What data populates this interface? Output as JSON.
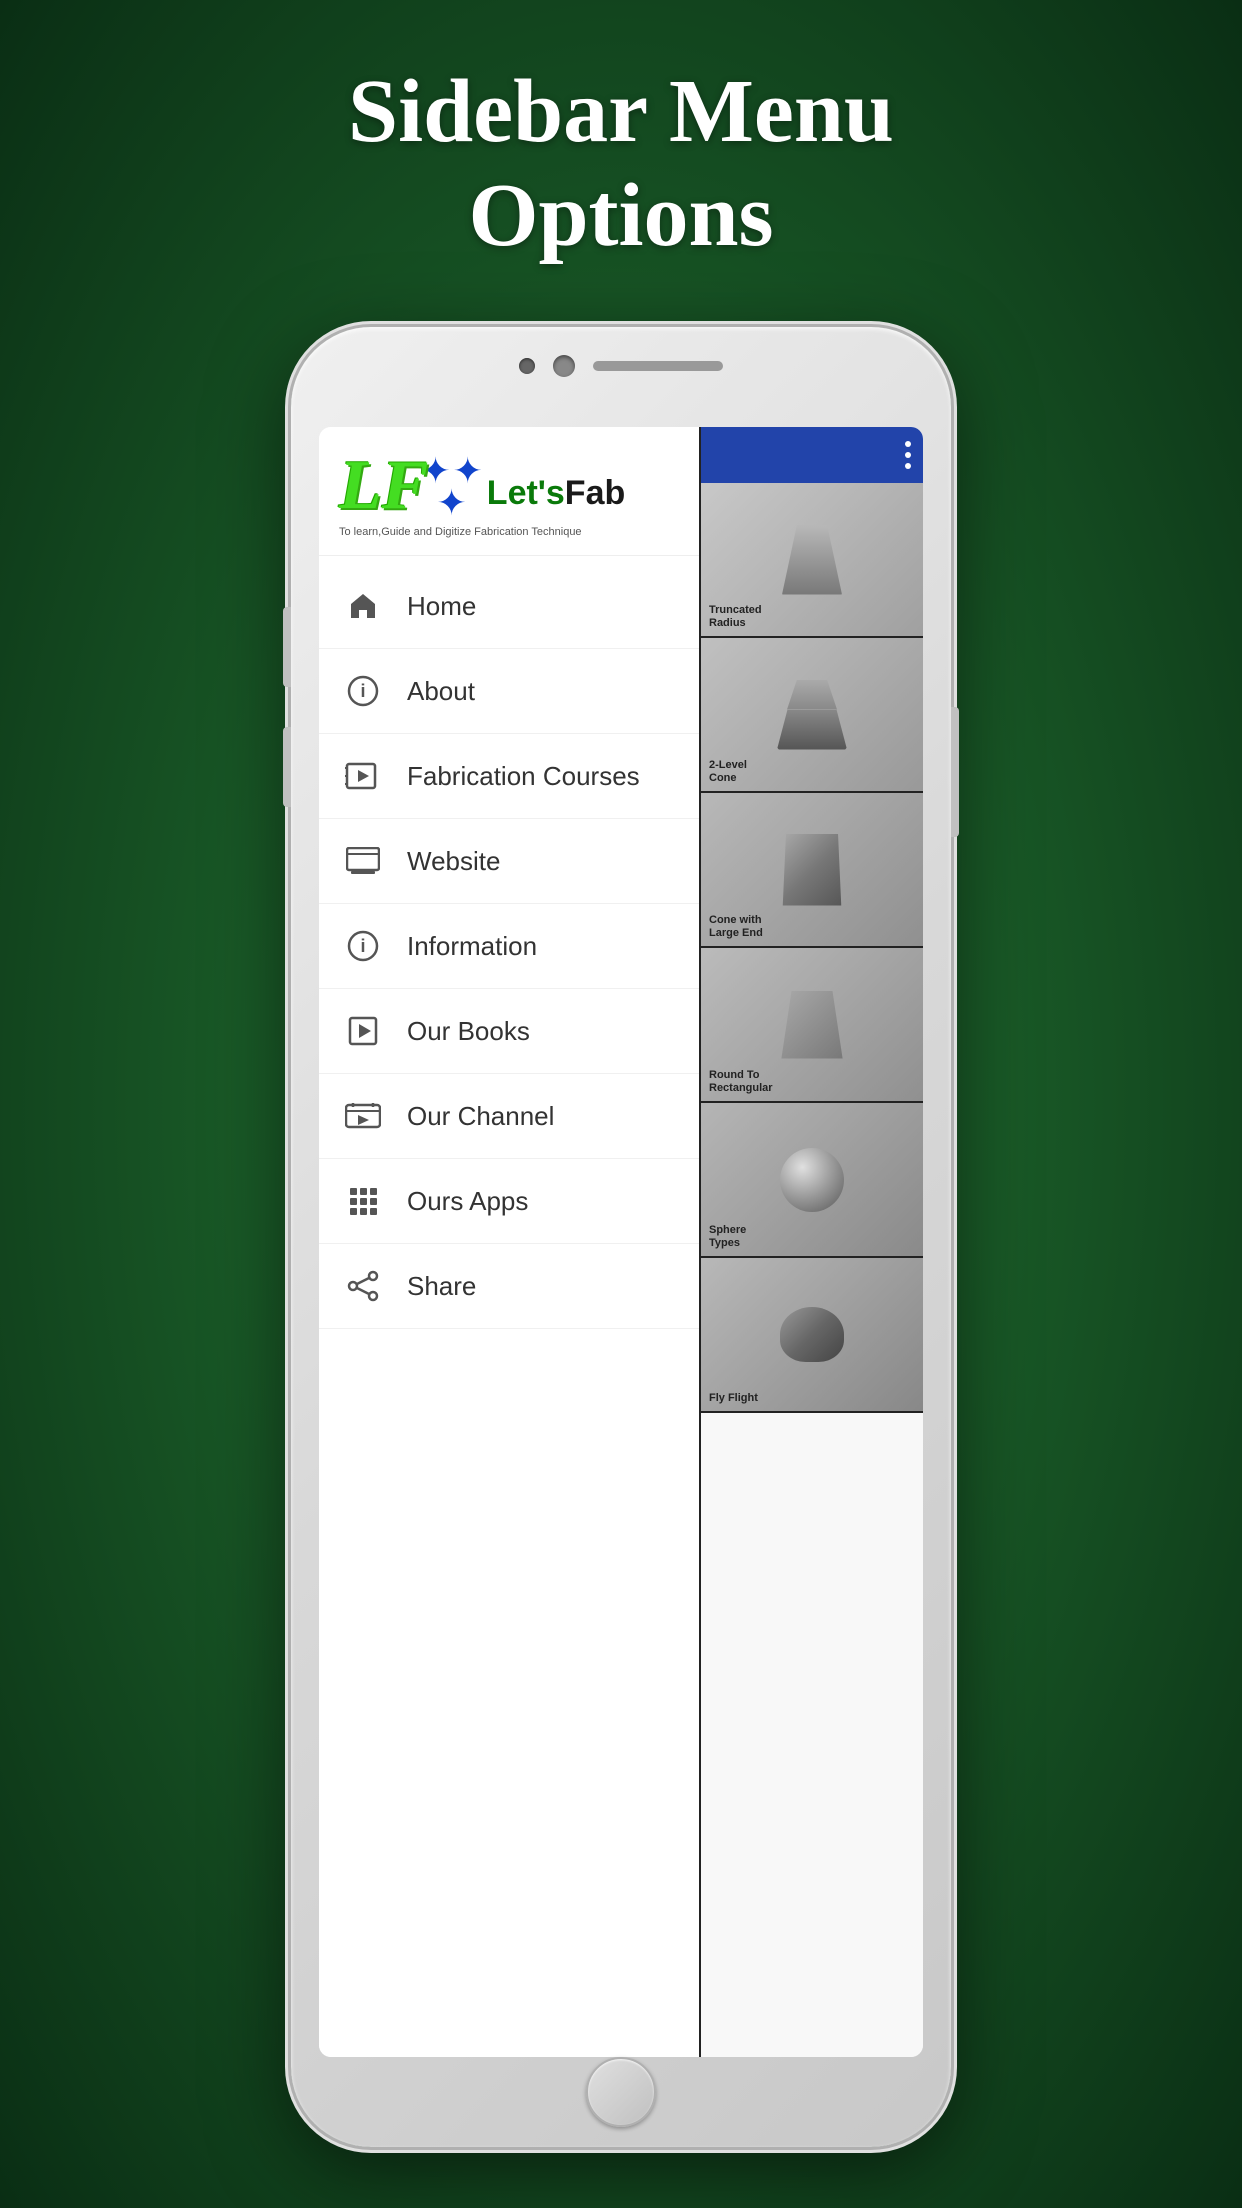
{
  "page": {
    "title_line1": "Sidebar Menu",
    "title_line2": "Options"
  },
  "brand": {
    "letters": "LF",
    "name_colored": "Let's",
    "name_dark": "Fab",
    "tagline": "To learn,Guide and Digitize Fabrication Technique"
  },
  "menu": {
    "items": [
      {
        "id": "home",
        "label": "Home",
        "icon": "home-icon"
      },
      {
        "id": "about",
        "label": "About",
        "icon": "info-icon"
      },
      {
        "id": "fabrication-courses",
        "label": "Fabrication Courses",
        "icon": "courses-icon"
      },
      {
        "id": "website",
        "label": "Website",
        "icon": "website-icon"
      },
      {
        "id": "information",
        "label": "Information",
        "icon": "info2-icon"
      },
      {
        "id": "our-books",
        "label": "Our Books",
        "icon": "books-icon"
      },
      {
        "id": "our-channel",
        "label": "Our Channel",
        "icon": "channel-icon"
      },
      {
        "id": "ours-apps",
        "label": "Ours Apps",
        "icon": "apps-icon"
      },
      {
        "id": "share",
        "label": "Share",
        "icon": "share-icon"
      }
    ]
  },
  "content_cards": [
    {
      "label": "Truncated\nRadius",
      "shape": "truncated"
    },
    {
      "label": "2-Level\nCone",
      "shape": "level"
    },
    {
      "label": "Cone with\nLarge End",
      "shape": "largeend"
    },
    {
      "label": "Round To\nRectangular",
      "shape": "rectangular"
    },
    {
      "label": "Sphere\nTypes",
      "shape": "sphere"
    },
    {
      "label": "Fly Flight",
      "shape": "flight"
    }
  ],
  "colors": {
    "brand_green": "#44dd22",
    "brand_dark_green": "#0a7a0a",
    "header_blue": "#2244aa",
    "bg_gradient_mid": "#2d8a3e",
    "bg_gradient_dark": "#0a2e14"
  }
}
